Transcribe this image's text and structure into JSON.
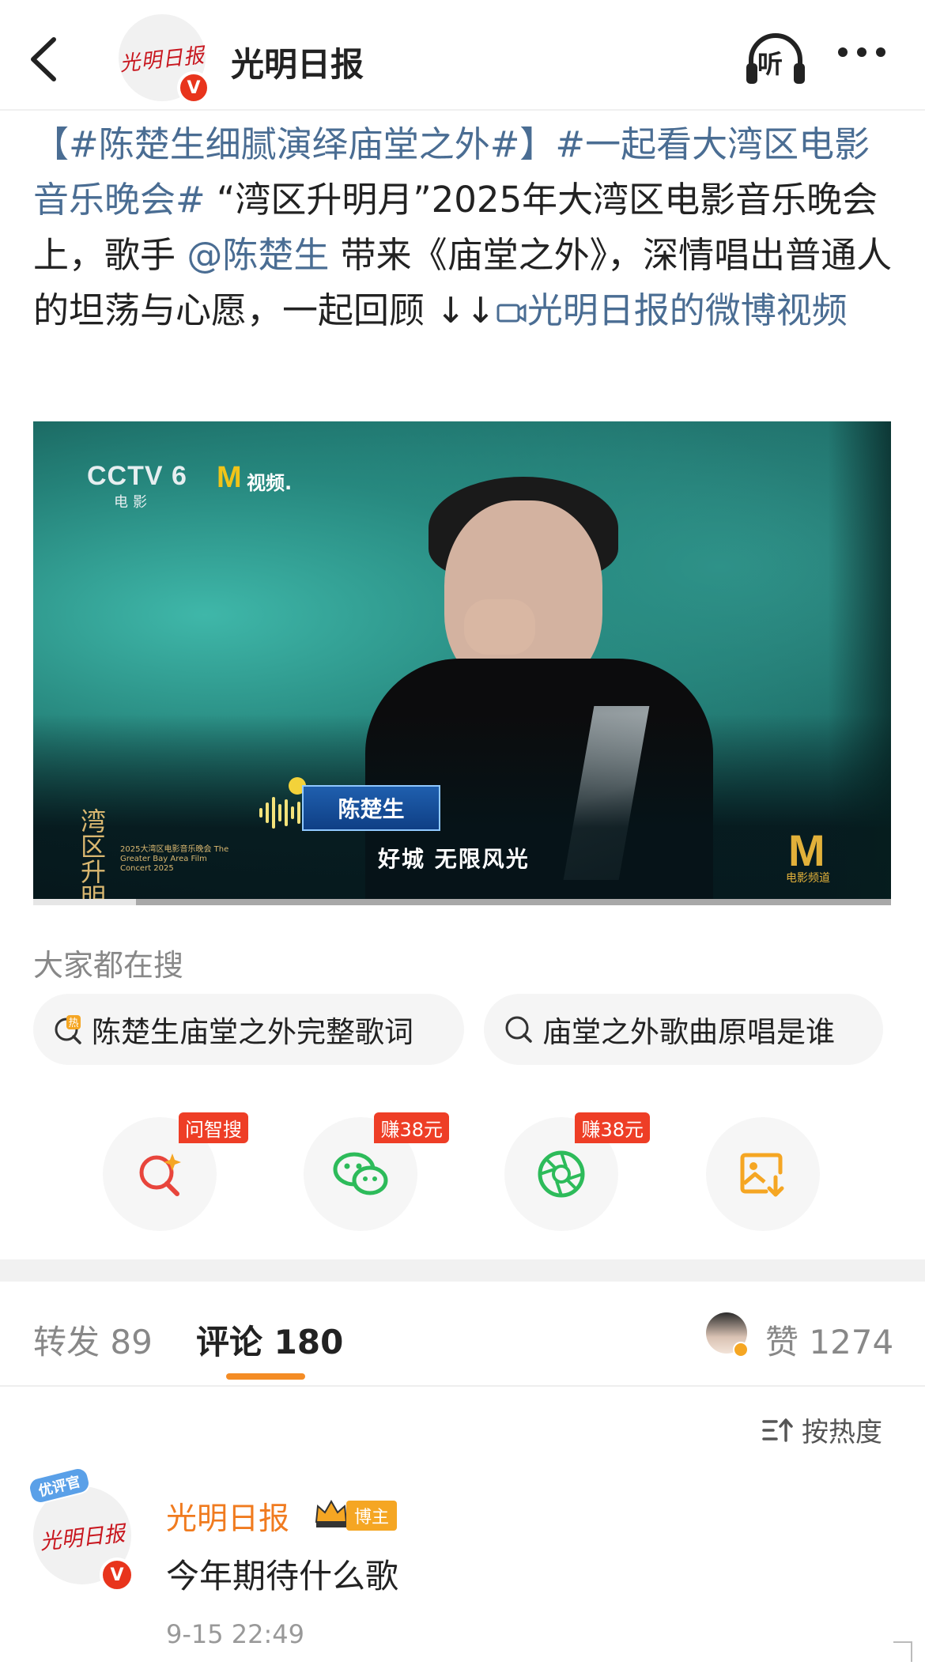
{
  "header": {
    "account_name": "光明日报",
    "logo_text": "光明日报",
    "verified_mark": "V",
    "listen_label": "听"
  },
  "post": {
    "hashtag1": "【#陈楚生细腻演绎庙堂之外#】",
    "hashtag2": "#一起看大湾区电影音乐晚会#",
    "text1": " “湾区升明月”2025年大湾区电影音乐晚会上，歌手",
    "mention": "@陈楚生",
    "text2": " 带来《庙堂之外》，深情唱出普通人的坦荡与心愿，一起回顾 ↓↓",
    "video_link": "光明日报的微博视频"
  },
  "video": {
    "channel_logo": "CCTV 6",
    "channel_sub": "电影",
    "app_logo": "M",
    "app_label": "视频.",
    "singer_name": "陈楚生",
    "subtitle": "好城 无限风光",
    "event_logo": "湾区升明月",
    "event_caption": "2025大湾区电影音乐晚会 The Greater Bay Area Film Concert 2025",
    "corner_logo": "M",
    "corner_caption": "电影频道",
    "progress": 0.12
  },
  "search": {
    "title": "大家都在搜",
    "items": [
      {
        "label": "陈楚生庙堂之外完整歌词",
        "icon": "hot-search-icon"
      },
      {
        "label": "庙堂之外歌曲原唱是谁",
        "icon": "search-icon"
      }
    ]
  },
  "actions": [
    {
      "icon": "ai-search-icon",
      "tag": "问智搜",
      "color": "#e8453c"
    },
    {
      "icon": "wechat-icon",
      "tag": "赚38元",
      "color": "#2dbb5a"
    },
    {
      "icon": "moments-icon",
      "tag": "赚38元",
      "color": "#2dbb5a"
    },
    {
      "icon": "save-image-icon",
      "tag": "",
      "color": "#f5a623"
    }
  ],
  "tabs": {
    "repost": "转发 89",
    "comment": "评论 180",
    "like": "赞 1274"
  },
  "sort_label": "按热度",
  "comment": {
    "badge": "优评官",
    "user": "光明日报",
    "owner_tag": "博主",
    "text": "今年期待什么歌",
    "time": "9-15 22:49"
  },
  "colors": {
    "link": "#4a6d93",
    "accent": "#f48c25",
    "comment_user": "#f07b1f"
  }
}
